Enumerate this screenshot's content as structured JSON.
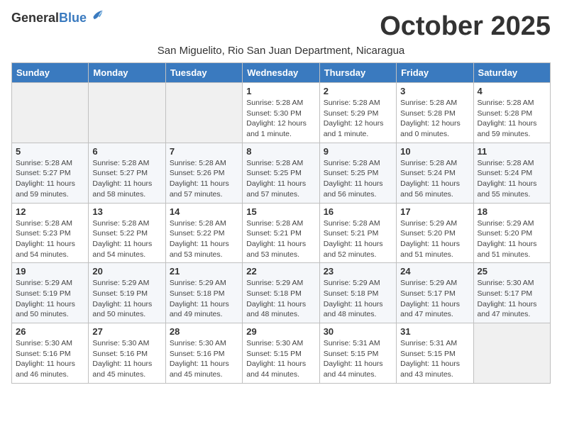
{
  "logo": {
    "general": "General",
    "blue": "Blue"
  },
  "title": "October 2025",
  "subtitle": "San Miguelito, Rio San Juan Department, Nicaragua",
  "days_of_week": [
    "Sunday",
    "Monday",
    "Tuesday",
    "Wednesday",
    "Thursday",
    "Friday",
    "Saturday"
  ],
  "weeks": [
    [
      {
        "day": "",
        "info": ""
      },
      {
        "day": "",
        "info": ""
      },
      {
        "day": "",
        "info": ""
      },
      {
        "day": "1",
        "info": "Sunrise: 5:28 AM\nSunset: 5:30 PM\nDaylight: 12 hours\nand 1 minute."
      },
      {
        "day": "2",
        "info": "Sunrise: 5:28 AM\nSunset: 5:29 PM\nDaylight: 12 hours\nand 1 minute."
      },
      {
        "day": "3",
        "info": "Sunrise: 5:28 AM\nSunset: 5:28 PM\nDaylight: 12 hours\nand 0 minutes."
      },
      {
        "day": "4",
        "info": "Sunrise: 5:28 AM\nSunset: 5:28 PM\nDaylight: 11 hours\nand 59 minutes."
      }
    ],
    [
      {
        "day": "5",
        "info": "Sunrise: 5:28 AM\nSunset: 5:27 PM\nDaylight: 11 hours\nand 59 minutes."
      },
      {
        "day": "6",
        "info": "Sunrise: 5:28 AM\nSunset: 5:27 PM\nDaylight: 11 hours\nand 58 minutes."
      },
      {
        "day": "7",
        "info": "Sunrise: 5:28 AM\nSunset: 5:26 PM\nDaylight: 11 hours\nand 57 minutes."
      },
      {
        "day": "8",
        "info": "Sunrise: 5:28 AM\nSunset: 5:25 PM\nDaylight: 11 hours\nand 57 minutes."
      },
      {
        "day": "9",
        "info": "Sunrise: 5:28 AM\nSunset: 5:25 PM\nDaylight: 11 hours\nand 56 minutes."
      },
      {
        "day": "10",
        "info": "Sunrise: 5:28 AM\nSunset: 5:24 PM\nDaylight: 11 hours\nand 56 minutes."
      },
      {
        "day": "11",
        "info": "Sunrise: 5:28 AM\nSunset: 5:24 PM\nDaylight: 11 hours\nand 55 minutes."
      }
    ],
    [
      {
        "day": "12",
        "info": "Sunrise: 5:28 AM\nSunset: 5:23 PM\nDaylight: 11 hours\nand 54 minutes."
      },
      {
        "day": "13",
        "info": "Sunrise: 5:28 AM\nSunset: 5:22 PM\nDaylight: 11 hours\nand 54 minutes."
      },
      {
        "day": "14",
        "info": "Sunrise: 5:28 AM\nSunset: 5:22 PM\nDaylight: 11 hours\nand 53 minutes."
      },
      {
        "day": "15",
        "info": "Sunrise: 5:28 AM\nSunset: 5:21 PM\nDaylight: 11 hours\nand 53 minutes."
      },
      {
        "day": "16",
        "info": "Sunrise: 5:28 AM\nSunset: 5:21 PM\nDaylight: 11 hours\nand 52 minutes."
      },
      {
        "day": "17",
        "info": "Sunrise: 5:29 AM\nSunset: 5:20 PM\nDaylight: 11 hours\nand 51 minutes."
      },
      {
        "day": "18",
        "info": "Sunrise: 5:29 AM\nSunset: 5:20 PM\nDaylight: 11 hours\nand 51 minutes."
      }
    ],
    [
      {
        "day": "19",
        "info": "Sunrise: 5:29 AM\nSunset: 5:19 PM\nDaylight: 11 hours\nand 50 minutes."
      },
      {
        "day": "20",
        "info": "Sunrise: 5:29 AM\nSunset: 5:19 PM\nDaylight: 11 hours\nand 50 minutes."
      },
      {
        "day": "21",
        "info": "Sunrise: 5:29 AM\nSunset: 5:18 PM\nDaylight: 11 hours\nand 49 minutes."
      },
      {
        "day": "22",
        "info": "Sunrise: 5:29 AM\nSunset: 5:18 PM\nDaylight: 11 hours\nand 48 minutes."
      },
      {
        "day": "23",
        "info": "Sunrise: 5:29 AM\nSunset: 5:18 PM\nDaylight: 11 hours\nand 48 minutes."
      },
      {
        "day": "24",
        "info": "Sunrise: 5:29 AM\nSunset: 5:17 PM\nDaylight: 11 hours\nand 47 minutes."
      },
      {
        "day": "25",
        "info": "Sunrise: 5:30 AM\nSunset: 5:17 PM\nDaylight: 11 hours\nand 47 minutes."
      }
    ],
    [
      {
        "day": "26",
        "info": "Sunrise: 5:30 AM\nSunset: 5:16 PM\nDaylight: 11 hours\nand 46 minutes."
      },
      {
        "day": "27",
        "info": "Sunrise: 5:30 AM\nSunset: 5:16 PM\nDaylight: 11 hours\nand 45 minutes."
      },
      {
        "day": "28",
        "info": "Sunrise: 5:30 AM\nSunset: 5:16 PM\nDaylight: 11 hours\nand 45 minutes."
      },
      {
        "day": "29",
        "info": "Sunrise: 5:30 AM\nSunset: 5:15 PM\nDaylight: 11 hours\nand 44 minutes."
      },
      {
        "day": "30",
        "info": "Sunrise: 5:31 AM\nSunset: 5:15 PM\nDaylight: 11 hours\nand 44 minutes."
      },
      {
        "day": "31",
        "info": "Sunrise: 5:31 AM\nSunset: 5:15 PM\nDaylight: 11 hours\nand 43 minutes."
      },
      {
        "day": "",
        "info": ""
      }
    ]
  ]
}
